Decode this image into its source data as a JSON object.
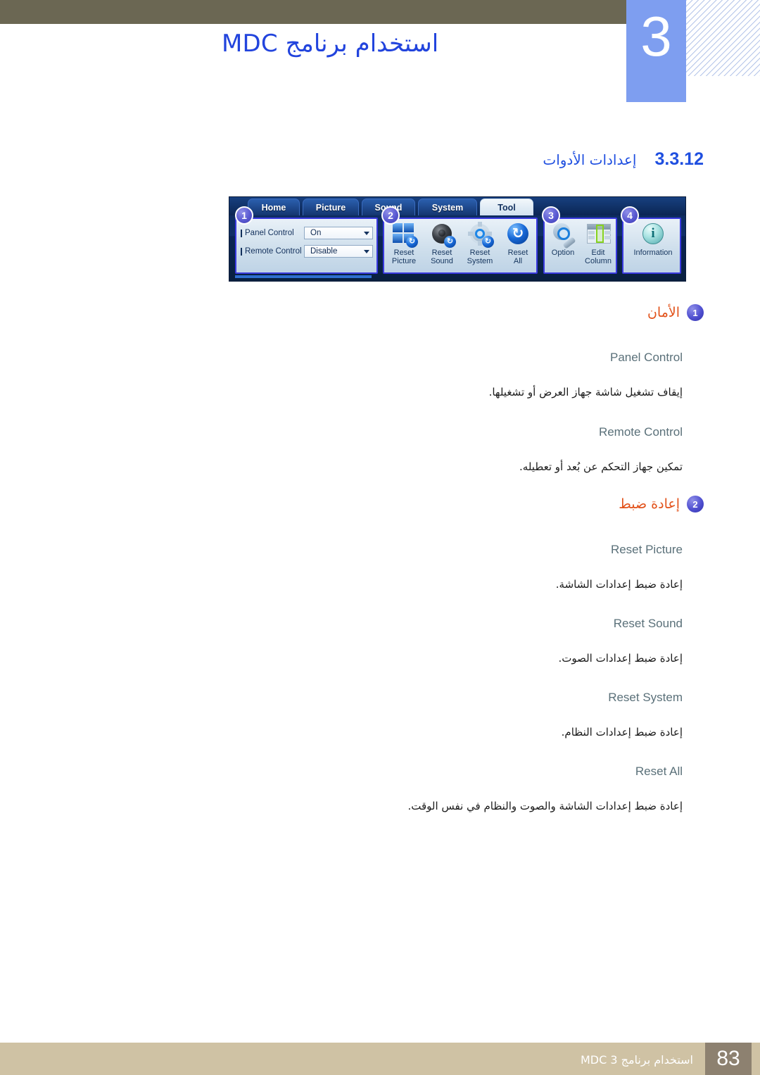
{
  "header": {
    "chapter_number": "3",
    "chapter_title": "استخدام برنامج MDC"
  },
  "section": {
    "number": "3.3.12",
    "title": "إعدادات الأدوات"
  },
  "screenshot": {
    "alt_name": "mdc-tool-tab-toolbar",
    "tabs": [
      {
        "label": "Home",
        "active": false
      },
      {
        "label": "Picture",
        "active": false
      },
      {
        "label": "Sound",
        "active": false
      },
      {
        "label": "System",
        "active": false
      },
      {
        "label": "Tool",
        "active": true
      }
    ],
    "group1": {
      "callout": "1",
      "controls": [
        {
          "label": "Panel Control",
          "value": "On"
        },
        {
          "label": "Remote Control",
          "value": "Disable"
        }
      ]
    },
    "group2": {
      "callout": "2",
      "buttons": [
        {
          "line1": "Reset",
          "line2": "Picture"
        },
        {
          "line1": "Reset",
          "line2": "Sound"
        },
        {
          "line1": "Reset",
          "line2": "System"
        },
        {
          "line1": "Reset",
          "line2": "All"
        }
      ]
    },
    "group3": {
      "callout": "3",
      "buttons": [
        {
          "line1": "Option",
          "line2": ""
        },
        {
          "line1": "Edit",
          "line2": "Column"
        }
      ]
    },
    "group4": {
      "callout": "4",
      "buttons": [
        {
          "line1": "Information",
          "line2": ""
        }
      ]
    }
  },
  "sections": [
    {
      "badge": "1",
      "heading": "الأمان",
      "entries": [
        {
          "term": "Panel Control",
          "desc": "إيقاف تشغيل شاشة جهاز العرض أو تشغيلها."
        },
        {
          "term": "Remote Control",
          "desc": "تمكين جهاز التحكم عن بُعد أو تعطيله."
        }
      ]
    },
    {
      "badge": "2",
      "heading": "إعادة ضبط",
      "entries": [
        {
          "term": "Reset Picture",
          "desc": "إعادة ضبط إعدادات الشاشة."
        },
        {
          "term": "Reset Sound",
          "desc": "إعادة ضبط إعدادات الصوت."
        },
        {
          "term": "Reset System",
          "desc": "إعادة ضبط إعدادات النظام."
        },
        {
          "term": "Reset All",
          "desc": "إعادة ضبط إعدادات الشاشة والصوت والنظام في نفس الوقت."
        }
      ]
    }
  ],
  "footer": {
    "text": "استخدام برنامج MDC 3",
    "page_number": "83"
  },
  "colors": {
    "header_bar": "#6b6753",
    "chapter_block": "#7e9ef0",
    "title_blue": "#2244dd",
    "section_blue": "#1f4fe0",
    "heading_orange": "#e2521a",
    "term_gray": "#5a7079",
    "footer_bar": "#cfc2a4",
    "footer_page_box": "#8d8170",
    "callout_badge": "#4f4fd0"
  }
}
